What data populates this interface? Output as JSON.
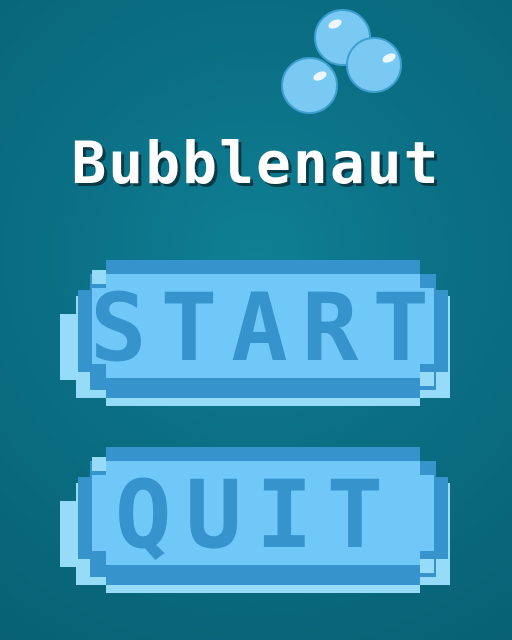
{
  "game": {
    "title": "Bubblenaut",
    "logo_icon": "bubbles-icon"
  },
  "menu": {
    "start_label": "START",
    "quit_label": "QUIT"
  },
  "colors": {
    "background": "#0b6f84",
    "button_fill": "#70c8f8",
    "button_dark": "#3693cc",
    "button_light": "#96dcf8",
    "title_text": "#ffffff"
  }
}
